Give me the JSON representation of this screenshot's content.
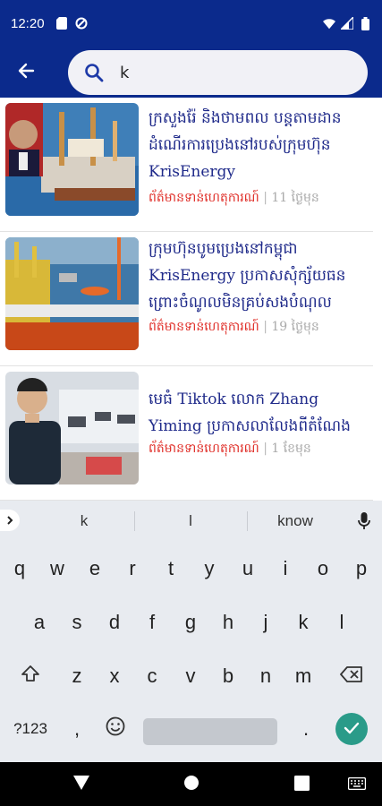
{
  "status_bar": {
    "time": "12:20"
  },
  "search": {
    "query": "k"
  },
  "articles": [
    {
      "title": "ក្រសួងរ៉ែ និងថាមពល បន្តតាមដានដំណើរការប្រេងនៅរបស់ក្រុមហ៊ុន KrisEnergy",
      "category": "ព័ត៌មានទាន់ហេតុការណ៍",
      "separator": "|",
      "time": "11 ថ្ងៃមុន"
    },
    {
      "title": "ក្រុមហ៊ុនបូមប្រេងនៅកម្ពុជា KrisEnergy ប្រកាសសុំក្ស័យធន ព្រោះចំណូលមិនគ្រប់សងបំណុល",
      "category": "ព័ត៌មានទាន់ហេតុការណ៍",
      "separator": "|",
      "time": "19 ថ្ងៃមុន"
    },
    {
      "title": "មេធំ Tiktok លោក Zhang Yiming ប្រកាសលាលែងពីតំណែង",
      "category": "ព័ត៌មានទាន់ហេតុការណ៍",
      "separator": "|",
      "time": "1 ខែមុន"
    }
  ],
  "keyboard": {
    "suggestions": [
      "k",
      "l",
      "know"
    ],
    "row1": [
      "q",
      "w",
      "e",
      "r",
      "t",
      "y",
      "u",
      "i",
      "o",
      "p"
    ],
    "row2": [
      "a",
      "s",
      "d",
      "f",
      "g",
      "h",
      "j",
      "k",
      "l"
    ],
    "row3": [
      "z",
      "x",
      "c",
      "v",
      "b",
      "n",
      "m"
    ],
    "symbols_label": "?123",
    "comma": ",",
    "period": "."
  },
  "colors": {
    "primary": "#0b2a8c",
    "title": "#1f2a8a",
    "category": "#e0302a",
    "enter": "#2a9b89"
  }
}
